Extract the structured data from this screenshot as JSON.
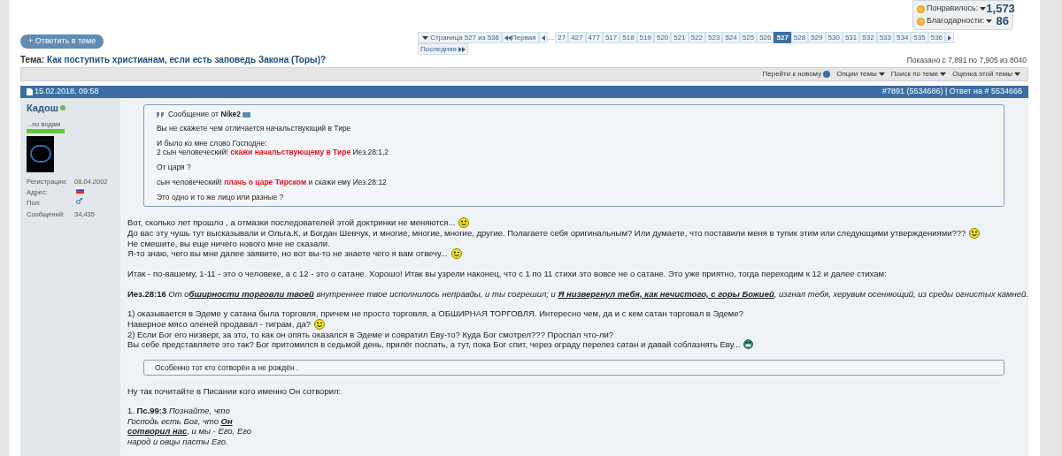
{
  "stats_box": {
    "items": [
      {
        "label": "Понравилось:",
        "value": "1,573"
      },
      {
        "label": "Благодарности:",
        "value": "86"
      }
    ]
  },
  "reply_button": "+ Ответить в теме",
  "pagination": {
    "page_menu": "Страница 527 из 536",
    "first": "Первая",
    "ellipsis": "...",
    "last": "Последняя",
    "pages": [
      {
        "label": "27",
        "selected": false
      },
      {
        "label": "427",
        "selected": false
      },
      {
        "label": "477",
        "selected": false
      },
      {
        "label": "517",
        "selected": false
      },
      {
        "label": "518",
        "selected": false
      },
      {
        "label": "519",
        "selected": false
      },
      {
        "label": "520",
        "selected": false
      },
      {
        "label": "521",
        "selected": false
      },
      {
        "label": "522",
        "selected": false
      },
      {
        "label": "523",
        "selected": false
      },
      {
        "label": "524",
        "selected": false
      },
      {
        "label": "525",
        "selected": false
      },
      {
        "label": "526",
        "selected": false
      },
      {
        "label": "527",
        "selected": true
      },
      {
        "label": "528",
        "selected": false
      },
      {
        "label": "529",
        "selected": false
      },
      {
        "label": "530",
        "selected": false
      },
      {
        "label": "531",
        "selected": false
      },
      {
        "label": "532",
        "selected": false
      },
      {
        "label": "533",
        "selected": false
      },
      {
        "label": "534",
        "selected": false
      },
      {
        "label": "535",
        "selected": false
      },
      {
        "label": "536",
        "selected": false
      }
    ]
  },
  "thread": {
    "label": "Тема:",
    "title": "Как поступить христианам, если есть заповедь Закона (Торы)?"
  },
  "shown_range": "Показано с 7,891 по 7,905 из 8040",
  "toolbar": [
    {
      "label": "Перейти к новому",
      "kind": "link"
    },
    {
      "label": "Опции темы",
      "kind": "menu"
    },
    {
      "label": "Поиск по теме",
      "kind": "menu"
    },
    {
      "label": "Оценка этой темы",
      "kind": "menu"
    }
  ],
  "post": {
    "date": "15.02.2018, 09:58",
    "post_ref": "#7891 (5534686) | Ответ на # 5534666",
    "author": {
      "name": "Кадош",
      "online": true,
      "title": "...по водам",
      "details": [
        {
          "label": "Регистрация:",
          "value": "08.04.2002",
          "kind": "text"
        },
        {
          "label": "Адрес:",
          "kind": "flag"
        },
        {
          "label": "Пол:",
          "kind": "male"
        },
        {
          "label": "Сообщений:",
          "value": "34,435",
          "kind": "text"
        }
      ]
    },
    "content": [
      {
        "kind": "quote",
        "header": "Сообщение от",
        "author": "Nike2",
        "paragraphs": [
          [
            [
              {
                "text": "Вы не скажете чем отличается начальствующий в Тире",
                "kind": "plain"
              }
            ]
          ],
          [
            [
              {
                "text": "И было ко мне слово Господне:",
                "kind": "plain"
              }
            ],
            [
              {
                "text": "2 сын человеческий! ",
                "kind": "plain"
              },
              {
                "text": "скажи начальствующему в Тире",
                "kind": "red"
              },
              {
                "text": " Иез.28:1,2",
                "kind": "plain"
              }
            ]
          ],
          [
            [
              {
                "text": "От царя ?",
                "kind": "plain"
              }
            ]
          ],
          [
            [
              {
                "text": "сын человеческий! ",
                "kind": "plain"
              },
              {
                "text": "плачь о царе Тирском",
                "kind": "red"
              },
              {
                "text": " и скажи ему Иез.28:12",
                "kind": "plain"
              }
            ]
          ],
          [
            [
              {
                "text": "Это одно и то же лицо или разные ?",
                "kind": "plain"
              }
            ]
          ]
        ]
      },
      {
        "kind": "paragraph",
        "lines": [
          [
            {
              "text": "Вот, сколько лет прошло , а отмазки последователей этой доктринки не меняются...",
              "kind": "plain"
            },
            {
              "kind": "smile"
            }
          ],
          [
            {
              "text": "До вас эту чушь тут высказывали и Ольга.К, и Богдан Шевчук, и многие, многие, многие, другие. Полагаете себя оригинальным? Или думаете, что поставили меня в тупик этим или следующими утверждениями???",
              "kind": "plain"
            },
            {
              "kind": "smile"
            }
          ],
          [
            {
              "text": "Не смешите, вы еще ничего нового мне не сказали.",
              "kind": "plain"
            }
          ],
          [
            {
              "text": "Я-то знаю, чего вы мне далее заявите, но вот вы-то не знаете чего я вам отвечу...",
              "kind": "plain"
            },
            {
              "kind": "wink"
            }
          ]
        ]
      },
      {
        "kind": "paragraph",
        "lines": [
          [
            {
              "text": "Итак - по-вашему, 1-11 - это о человеке, а с 12 - это о сатане. Хорошо! Итак вы узрели наконец, что с 1 по 11 стихи это вовсе не о сатане. Это уже приятно, тогда переходим к 12 и далее стихам:",
              "kind": "plain"
            }
          ]
        ]
      },
      {
        "kind": "paragraph",
        "lines": [
          [
            {
              "text": "Иез.28:16",
              "kind": "bold"
            },
            {
              "text": " От о",
              "kind": "italic"
            },
            {
              "text": "бширности торговли твоей",
              "kind": "emphasis"
            },
            {
              "text": " внутреннее твое исполнилось неправды, и ты согрешил; и ",
              "kind": "italic"
            },
            {
              "text": "Я низвергнул тебя, как нечистого, с горы Божией",
              "kind": "emphasis"
            },
            {
              "text": ", изгнал тебя, херувим осеняющий, из среды огнистых камней.",
              "kind": "italic"
            }
          ]
        ]
      },
      {
        "kind": "paragraph",
        "lines": [
          [
            {
              "text": "1) оказывается в Эдеме у сатана была торговля, причем не просто торговля, а ОБШИРНАЯ ТОРГОВЛЯ. Интересно чем, да и с кем сатан торговал в Эдеме?",
              "kind": "plain"
            }
          ],
          [
            {
              "text": "Наверное мясо оленей продавал - тиграм, да?",
              "kind": "plain"
            },
            {
              "kind": "wink"
            }
          ],
          [
            {
              "text": "2) Если Бог его низверг, за это, то как он опять оказался в Эдеме и совратил Еву-то? Куда Бог смотрел??? Проспал что-ли?",
              "kind": "plain"
            }
          ],
          [
            {
              "text": "Вы себе представляете это так? Бог притомился в седьмой день, прилёг поспать, а тут, пока Бог спит, через ограду перелез сатан и давай соблазнять Еву...",
              "kind": "plain"
            },
            {
              "kind": "laugh"
            }
          ]
        ]
      },
      {
        "kind": "short_quote",
        "text": "Особенно тот кто сотворён а не рождён ."
      },
      {
        "kind": "paragraph",
        "lines": [
          [
            {
              "text": "Ну так почитайте в Писании кого именно Он сотворил:",
              "kind": "plain"
            }
          ]
        ]
      },
      {
        "kind": "paragraph",
        "lines": [
          [
            {
              "text": "1. ",
              "kind": "plain"
            },
            {
              "text": "Пс.99:3",
              "kind": "bold"
            },
            {
              "text": " Познайте, что",
              "kind": "italic"
            }
          ],
          [
            {
              "text": "Господь есть Бог, что ",
              "kind": "italic"
            },
            {
              "text": "Он",
              "kind": "emphasis"
            }
          ],
          [
            {
              "text": "сотворил нас",
              "kind": "emphasis"
            },
            {
              "text": ", и мы - Его, Его",
              "kind": "italic"
            }
          ],
          [
            {
              "text": "народ и овцы пасты Его.",
              "kind": "italic"
            }
          ]
        ]
      }
    ]
  }
}
